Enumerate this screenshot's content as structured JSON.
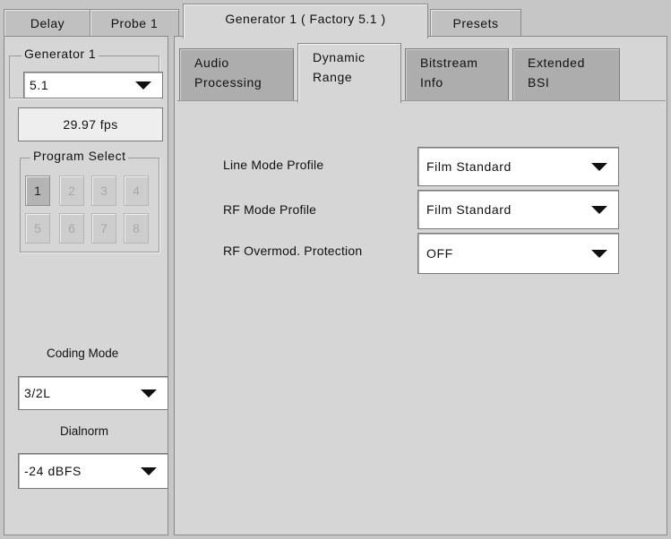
{
  "top_tabs": [
    {
      "label": "Delay",
      "active": false
    },
    {
      "label": "Probe 1",
      "active": false
    },
    {
      "label": "Generator 1 ( Factory 5.1 )",
      "active": true
    },
    {
      "label": "Presets",
      "active": false
    }
  ],
  "sidebar": {
    "group_title": "Generator 1",
    "channel_select": "5.1",
    "frame_rate": "29.97 fps",
    "program_select": {
      "title": "Program Select",
      "buttons": [
        "1",
        "2",
        "3",
        "4",
        "5",
        "6",
        "7",
        "8"
      ],
      "selected": "1"
    },
    "coding_mode_label": "Coding Mode",
    "coding_mode_value": "3/2L",
    "dialnorm_label": "Dialnorm",
    "dialnorm_value": "-24 dBFS"
  },
  "sub_tabs": [
    {
      "line1": "Audio",
      "line2": "Processing",
      "active": false
    },
    {
      "line1": "Dynamic",
      "line2": "Range",
      "active": true
    },
    {
      "line1": "Bitstream",
      "line2": "Info",
      "active": false
    },
    {
      "line1": "Extended",
      "line2": "BSI",
      "active": false
    }
  ],
  "dynamic_range": {
    "fields": [
      {
        "label": "Line Mode Profile",
        "value": "Film Standard"
      },
      {
        "label": "RF Mode Profile",
        "value": "Film Standard"
      },
      {
        "label": "RF Overmod. Protection",
        "value": "OFF"
      }
    ]
  }
}
